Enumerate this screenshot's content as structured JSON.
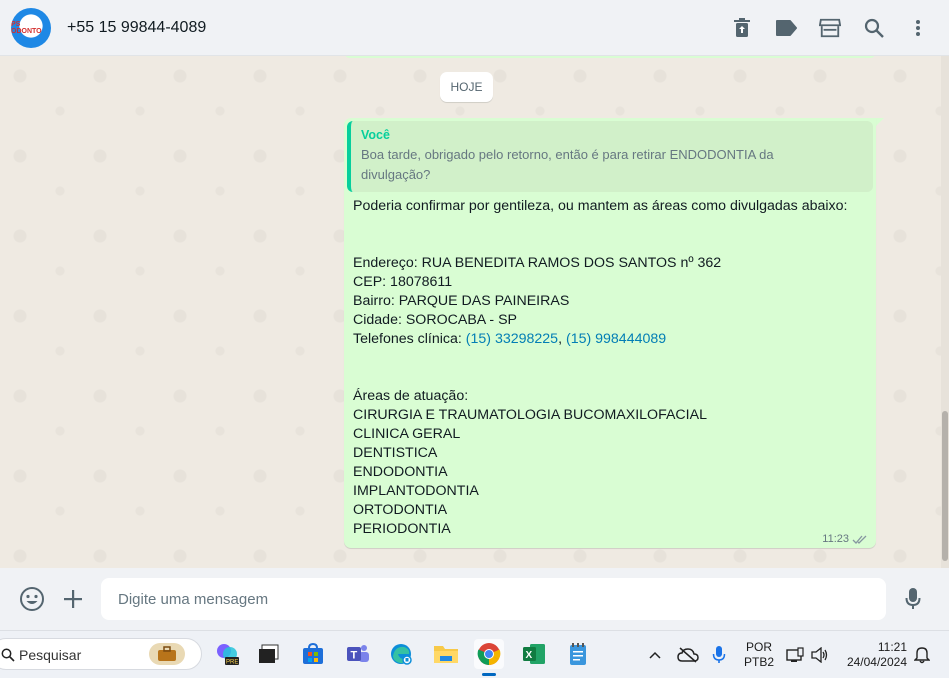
{
  "header": {
    "avatar_text": "PS ODONTO",
    "contact_name": "+55 15 99844-4089",
    "icons": [
      "delete-icon",
      "label-icon",
      "store-icon",
      "search-icon",
      "more-vert-icon"
    ]
  },
  "chat": {
    "date_chip": "HOJE",
    "message": {
      "quote_author": "Você",
      "quote_line1": "Boa tarde, obrigado pelo retorno, então é para retirar ENDODONTIA da",
      "quote_line2": "divulgação?",
      "intro": "Poderia confirmar por gentileza, ou mantem as áreas como divulgadas abaixo:",
      "address": "Endereço: RUA BENEDITA RAMOS DOS SANTOS nº 362",
      "cep": "CEP: 18078611",
      "bairro": "Bairro: PARQUE DAS PAINEIRAS",
      "cidade": "Cidade: SOROCABA - SP",
      "phones_label": "Telefones clínica: ",
      "phone1": "(15) 33298225",
      "phone_sep": ", ",
      "phone2": "(15) 998444089",
      "areas_title": "Áreas de atuação:",
      "areas": [
        "CIRURGIA E TRAUMATOLOGIA BUCOMAXILOFACIAL",
        "CLINICA GERAL",
        "DENTISTICA",
        "ENDODONTIA",
        "IMPLANTODONTIA",
        "ORTODONTIA",
        "PERIODONTIA"
      ],
      "time": "11:23",
      "status": "delivered"
    }
  },
  "composer": {
    "placeholder": "Digite uma mensagem"
  },
  "taskbar": {
    "search_label": "Pesquisar",
    "lang_top": "POR",
    "lang_bottom": "PTB2",
    "time": "11:21",
    "date": "24/04/2024"
  },
  "colors": {
    "bubble": "#d9fdd3",
    "quote_accent": "#06cf9c",
    "link": "#027eb5",
    "chat_bg": "#efeae2"
  }
}
